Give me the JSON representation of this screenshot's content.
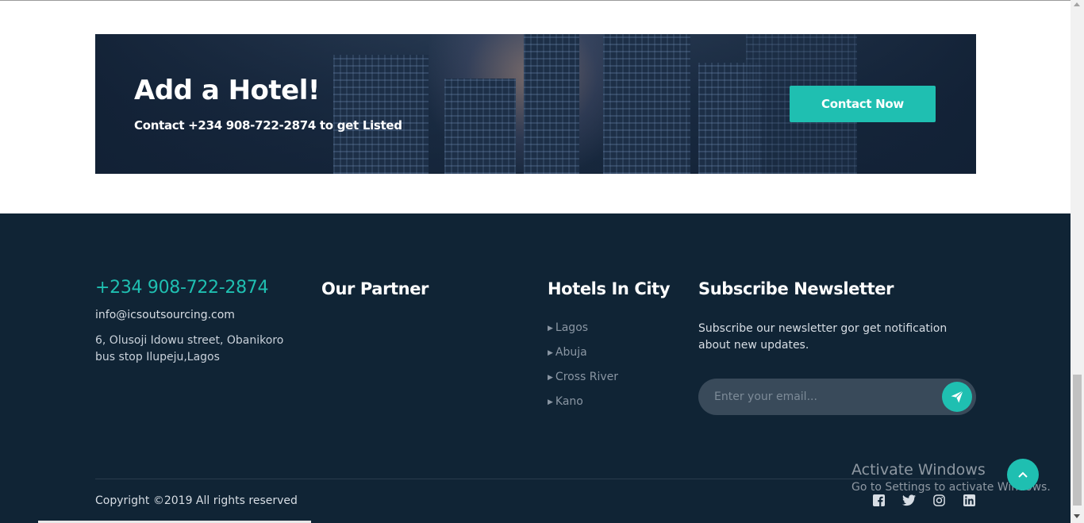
{
  "banner": {
    "title": "Add a Hotel!",
    "subtitle": "Contact +234 908-722-2874 to get Listed",
    "button_label": "Contact Now"
  },
  "footer": {
    "contact": {
      "phone": "+234 908-722-2874",
      "email": "info@icsoutsourcing.com",
      "address": "6, Olusoji Idowu street, Obanikoro bus stop Ilupeju,Lagos"
    },
    "partner_heading": "Our Partner",
    "cities_heading": "Hotels In City",
    "cities": [
      "Lagos",
      "Abuja",
      "Cross River",
      "Kano"
    ],
    "newsletter": {
      "heading": "Subscribe Newsletter",
      "text": "Subscribe our newsletter gor get notification about new updates.",
      "placeholder": "Enter your email..."
    },
    "copyright": "Copyright ©2019 All rights reserved",
    "socials": [
      "facebook-icon",
      "twitter-icon",
      "instagram-icon",
      "linkedin-icon"
    ]
  },
  "windows_watermark": {
    "title": "Activate Windows",
    "subtitle": "Go to Settings to activate Windows."
  },
  "colors": {
    "accent": "#1fbfb1",
    "footer_bg": "#102435",
    "banner_bg": "#15263b"
  }
}
